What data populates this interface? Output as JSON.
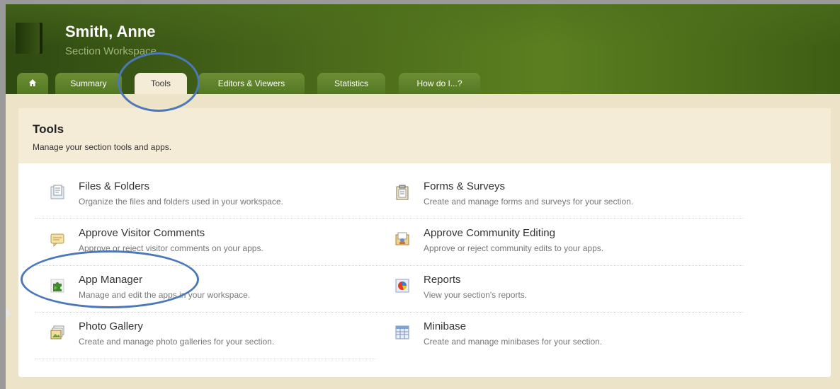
{
  "header": {
    "title": "Smith, Anne",
    "subtitle": "Section Workspace"
  },
  "tabs": [
    {
      "label": "",
      "icon": "home-icon"
    },
    {
      "label": "Summary"
    },
    {
      "label": "Tools",
      "active": true
    },
    {
      "label": "Editors & Viewers"
    },
    {
      "label": "Statistics"
    },
    {
      "label": "How do I...?"
    }
  ],
  "panel": {
    "title": "Tools",
    "description": "Manage your section tools and apps."
  },
  "tools": [
    {
      "name": "Files & Folders",
      "description": "Organize the files and folders used in your workspace.",
      "icon": "files-folders-icon"
    },
    {
      "name": "Forms & Surveys",
      "description": "Create and manage forms and surveys for your section.",
      "icon": "clipboard-icon"
    },
    {
      "name": "Approve Visitor Comments",
      "description": "Approve or reject visitor comments on your apps.",
      "icon": "comment-icon"
    },
    {
      "name": "Approve Community Editing",
      "description": "Approve or reject community edits to your apps.",
      "icon": "community-edit-icon"
    },
    {
      "name": "App Manager",
      "description": "Manage and edit the apps in your workspace.",
      "icon": "puzzle-icon"
    },
    {
      "name": "Reports",
      "description": "View your section's reports.",
      "icon": "pie-chart-icon"
    },
    {
      "name": "Photo Gallery",
      "description": "Create and manage photo galleries for your section.",
      "icon": "photo-gallery-icon"
    },
    {
      "name": "Minibase",
      "description": "Create and manage minibases for your section.",
      "icon": "minibase-icon"
    }
  ],
  "colors": {
    "header_green": "#4c6b1b",
    "tab_green": "#6d8e34",
    "panel_cream": "#f4ecd7",
    "annotation_blue": "#4d78b8"
  }
}
